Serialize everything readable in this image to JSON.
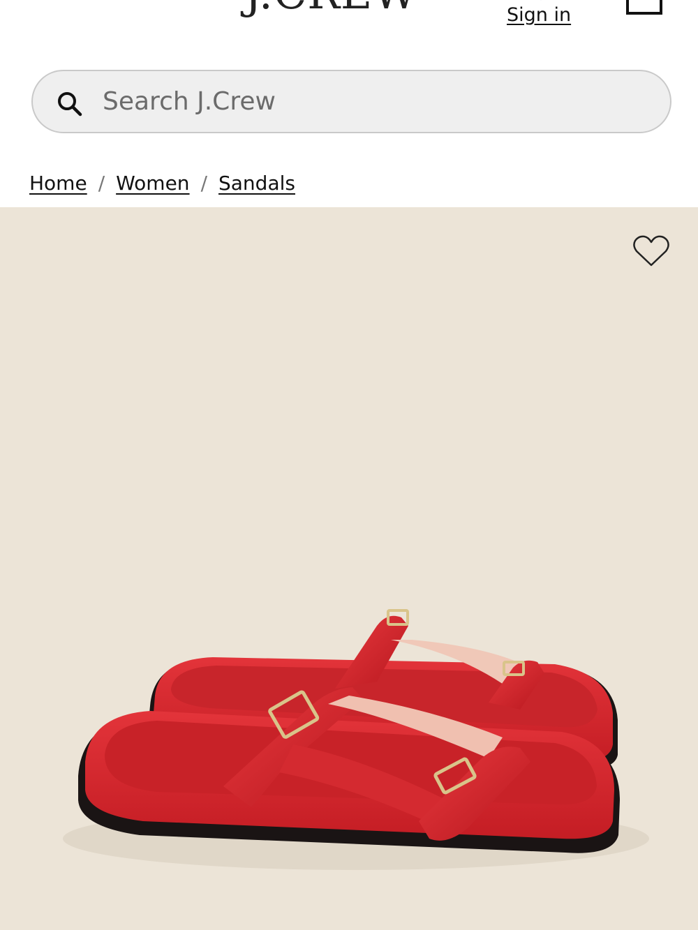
{
  "header": {
    "menu_icon": "hamburger-menu-icon",
    "logo_text": "J.CREW",
    "sign_in_label": "Sign in",
    "account_icon": "user-icon",
    "bag_icon": "shopping-bag-icon"
  },
  "search": {
    "icon": "search-icon",
    "placeholder": "Search J.Crew"
  },
  "breadcrumb": {
    "items": [
      {
        "label": "Home"
      },
      {
        "label": "Women"
      },
      {
        "label": "Sandals"
      }
    ],
    "separator": "/"
  },
  "product": {
    "image_description_icon": "sandal-image",
    "wishlist_icon": "heart-icon",
    "colors": {
      "background": "#ece4d7",
      "sandal": "#d8262b",
      "sole": "#1a1414",
      "buckle": "#d9c48a"
    }
  }
}
